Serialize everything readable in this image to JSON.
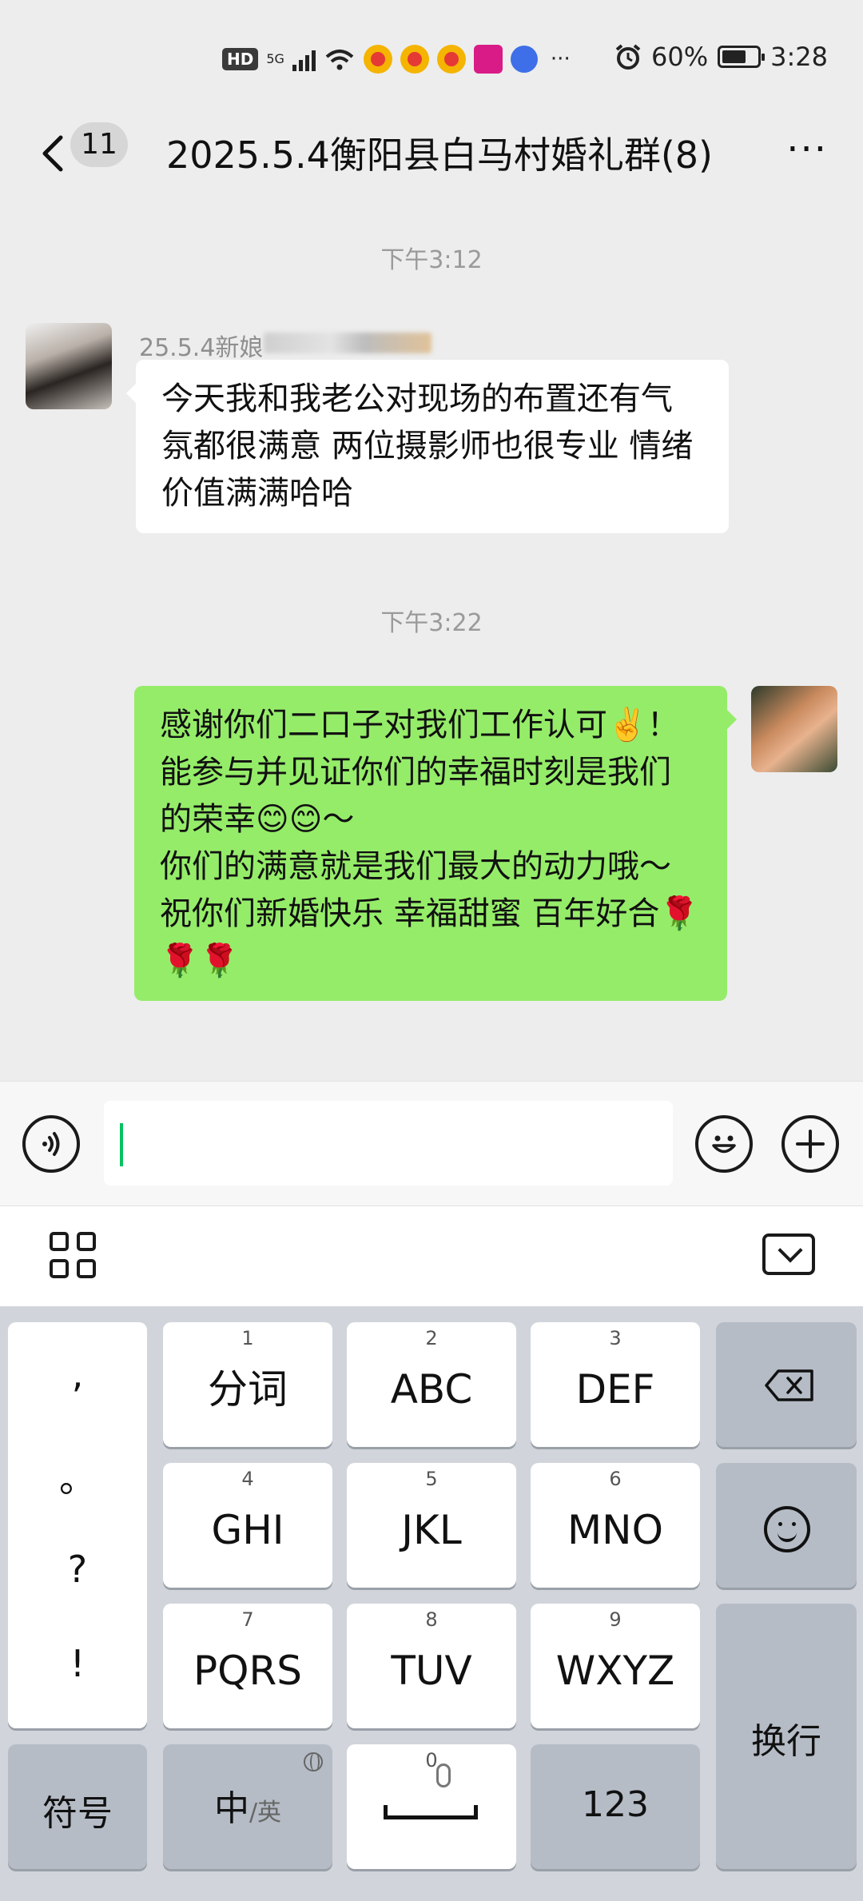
{
  "status_bar": {
    "hd": "HD",
    "network": "5G",
    "battery_pct": "60%",
    "time": "3:28",
    "overflow": "···"
  },
  "header": {
    "unread_count": "11",
    "title": "2025.5.4衡阳县白马村婚礼群(8)",
    "more": "···"
  },
  "chat": {
    "messages": [
      {
        "time": "下午3:12",
        "sender": "25.5.4新娘",
        "text": "今天我和我老公对现场的布置还有气氛都很满意 两位摄影师也很专业 情绪价值满满哈哈"
      },
      {
        "time": "下午3:22",
        "text": "感谢你们二口子对我们工作认可✌️！能参与并见证你们的幸福时刻是我们的荣幸😊😊～\n你们的满意就是我们最大的动力哦～\n祝你们新婚快乐 幸福甜蜜 百年好合🌹🌹🌹"
      }
    ]
  },
  "input": {
    "value": "",
    "placeholder": ""
  },
  "keyboard": {
    "punct": [
      ",",
      "。",
      "?",
      "!"
    ],
    "keys": [
      {
        "num": "1",
        "label": "分词"
      },
      {
        "num": "2",
        "label": "ABC"
      },
      {
        "num": "3",
        "label": "DEF"
      },
      {
        "num": "4",
        "label": "GHI"
      },
      {
        "num": "5",
        "label": "JKL"
      },
      {
        "num": "6",
        "label": "MNO"
      },
      {
        "num": "7",
        "label": "PQRS"
      },
      {
        "num": "8",
        "label": "TUV"
      },
      {
        "num": "9",
        "label": "WXYZ"
      }
    ],
    "symbols": "符号",
    "lang_main": "中",
    "lang_alt": "/英",
    "space_num": "0",
    "numbers": "123",
    "enter": "换行"
  },
  "colors": {
    "accent": "#07c160",
    "bubble_self": "#95ec69",
    "background": "#ededed"
  }
}
